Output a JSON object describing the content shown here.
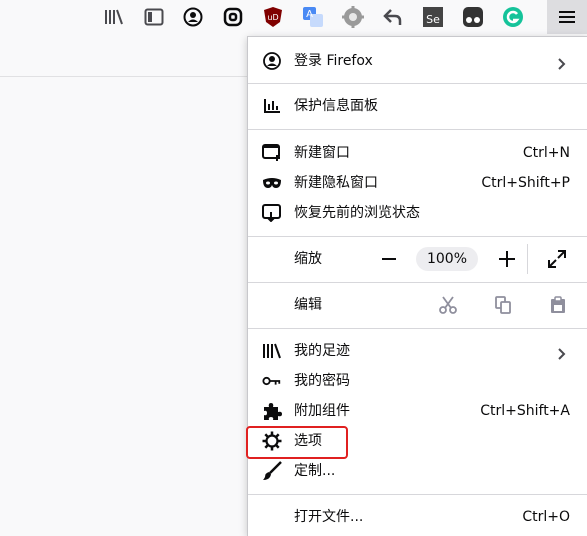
{
  "toolbar": {
    "icons": [
      "library-icon",
      "sidebar-icon",
      "account-icon",
      "extension-icon",
      "ublock-icon",
      "translate-icon",
      "gear-extension-icon",
      "back-arrow-icon",
      "selenium-icon",
      "tampermonkey-icon",
      "grammarly-icon"
    ],
    "menu_icon": "hamburger-menu-icon",
    "ublock_text": "uD",
    "selenium_text": "Se"
  },
  "menu": {
    "sign_in": {
      "label": "登录 Firefox"
    },
    "protection": {
      "label": "保护信息面板"
    },
    "new_window": {
      "label": "新建窗口",
      "shortcut": "Ctrl+N"
    },
    "private_window": {
      "label": "新建隐私窗口",
      "shortcut": "Ctrl+Shift+P"
    },
    "restore_session": {
      "label": "恢复先前的浏览状态"
    },
    "zoom": {
      "label": "缩放",
      "minus": "−",
      "value": "100%",
      "plus": "+"
    },
    "edit": {
      "label": "编辑"
    },
    "library": {
      "label": "我的足迹"
    },
    "logins": {
      "label": "我的密码"
    },
    "addons": {
      "label": "附加组件",
      "shortcut": "Ctrl+Shift+A"
    },
    "options": {
      "label": "选项"
    },
    "customize": {
      "label": "定制..."
    },
    "open_file": {
      "label": "打开文件...",
      "shortcut": "Ctrl+O"
    }
  },
  "colors": {
    "highlight": "#e02020",
    "panel_bg": "#ffffff",
    "toolbar_bg": "#f9f9fa"
  }
}
